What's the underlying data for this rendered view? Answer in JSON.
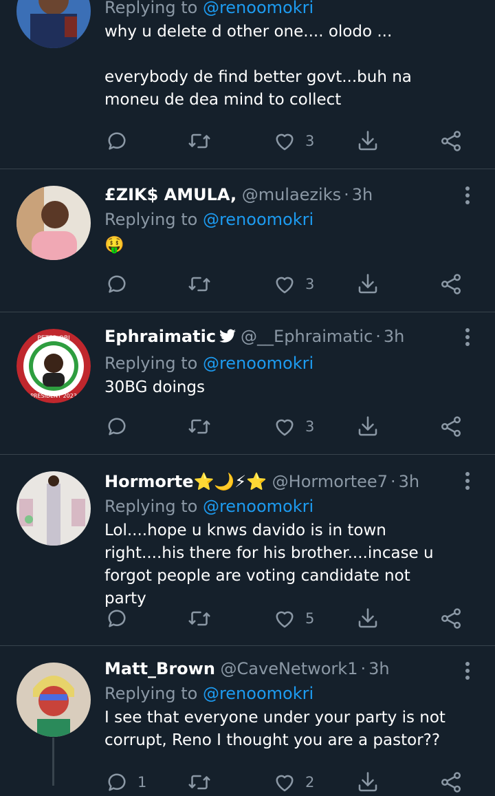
{
  "accent": "#1d9bf0",
  "background": "#15202b",
  "tweets": [
    {
      "name": "",
      "handle": "",
      "time": "",
      "replying_label": "Replying to",
      "reply_to": "@renoomokri",
      "text": "why u delete d other one.... olodo ...\n\neverybody de find better govt...buh na moneu de dea mind to collect",
      "reply_count": "",
      "retweet_count": "",
      "like_count": "3"
    },
    {
      "name": "£ZIK$ AMULA,",
      "handle": "@mulaeziks",
      "time": "3h",
      "replying_label": "Replying to",
      "reply_to": "@renoomokri",
      "text": "🤑",
      "reply_count": "",
      "retweet_count": "",
      "like_count": "3"
    },
    {
      "name": "Ephraimatic",
      "verified": true,
      "handle": "@__Ephraimatic",
      "time": "3h",
      "replying_label": "Replying to",
      "reply_to": "@renoomokri",
      "text": "30BG doings",
      "avatar_text_top": "PETER OBI",
      "avatar_text_bottom": "PRESIDENT 2023",
      "reply_count": "",
      "retweet_count": "",
      "like_count": "3"
    },
    {
      "name": "Hormorte⭐🌙⚡⭐",
      "handle": "@Hormortee7",
      "time": "3h",
      "replying_label": "Replying to",
      "reply_to": "@renoomokri",
      "text": "Lol....hope u knws davido is in town right....his there for his brother....incase u forgot people are voting candidate not party",
      "reply_count": "",
      "retweet_count": "",
      "like_count": "5"
    },
    {
      "name": "Matt_Brown",
      "handle": "@CaveNetwork1",
      "time": "3h",
      "replying_label": "Replying to",
      "reply_to": "@renoomokri",
      "text": "I see that everyone under your party is not corrupt, Reno I thought you are a pastor??",
      "reply_count": "1",
      "retweet_count": "",
      "like_count": "2"
    }
  ],
  "icons": {
    "reply": "reply-icon",
    "retweet": "retweet-icon",
    "like": "heart-icon",
    "bookmark": "download-icon",
    "share": "share-icon",
    "more": "more-icon",
    "verified": "verified-bird-icon"
  }
}
